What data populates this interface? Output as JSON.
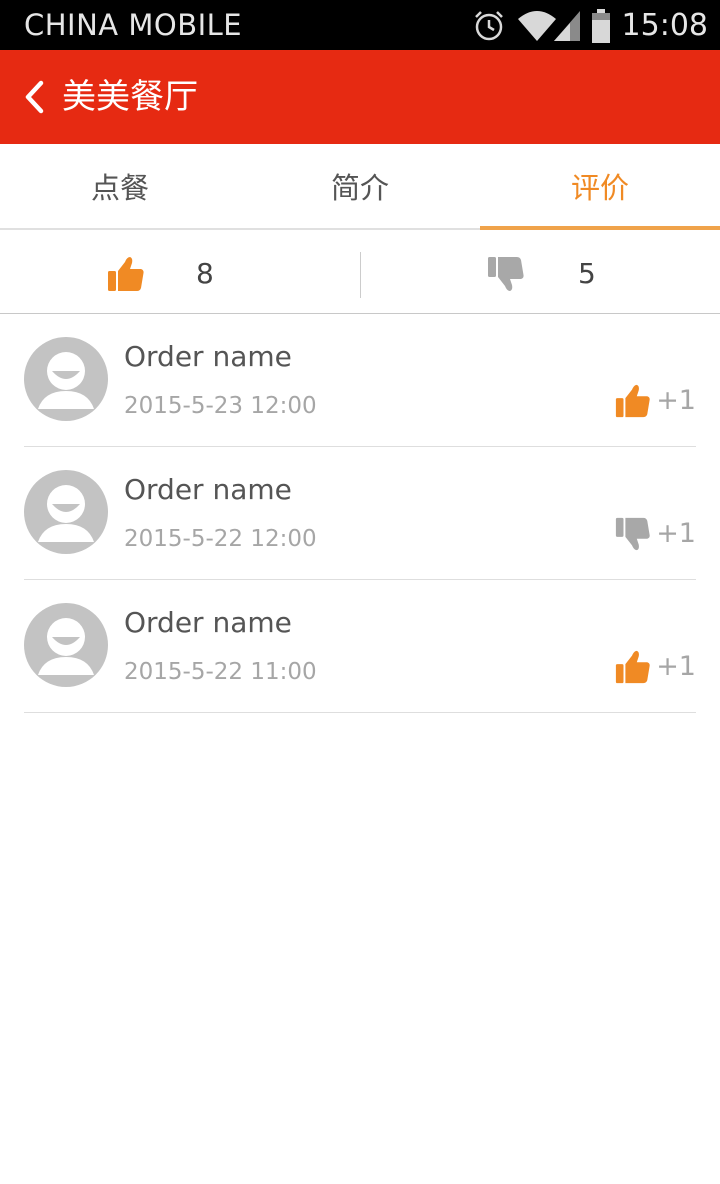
{
  "status_bar": {
    "carrier": "CHINA  MOBILE",
    "time": "15:08",
    "icons": [
      "alarm-icon",
      "wifi-icon",
      "signal-icon",
      "battery-icon"
    ]
  },
  "header": {
    "title": "美美餐厅",
    "background_color": "#e62a12",
    "back_icon": "chevron-left-icon"
  },
  "tabs": [
    {
      "label": "点餐",
      "active": false
    },
    {
      "label": "简介",
      "active": false
    },
    {
      "label": "评价",
      "active": true
    }
  ],
  "accent_color": "#f08a24",
  "vote_summary": {
    "likes": "8",
    "dislikes": "5",
    "like_icon": "thumbs-up-icon",
    "dislike_icon": "thumbs-down-icon"
  },
  "reviews": [
    {
      "name": "Order name",
      "date": "2015-5-23  12:00",
      "vote": "up",
      "plus": "+1"
    },
    {
      "name": "Order name",
      "date": "2015-5-22  12:00",
      "vote": "down",
      "plus": "+1"
    },
    {
      "name": "Order name",
      "date": "2015-5-22  11:00",
      "vote": "up",
      "plus": "+1"
    }
  ]
}
